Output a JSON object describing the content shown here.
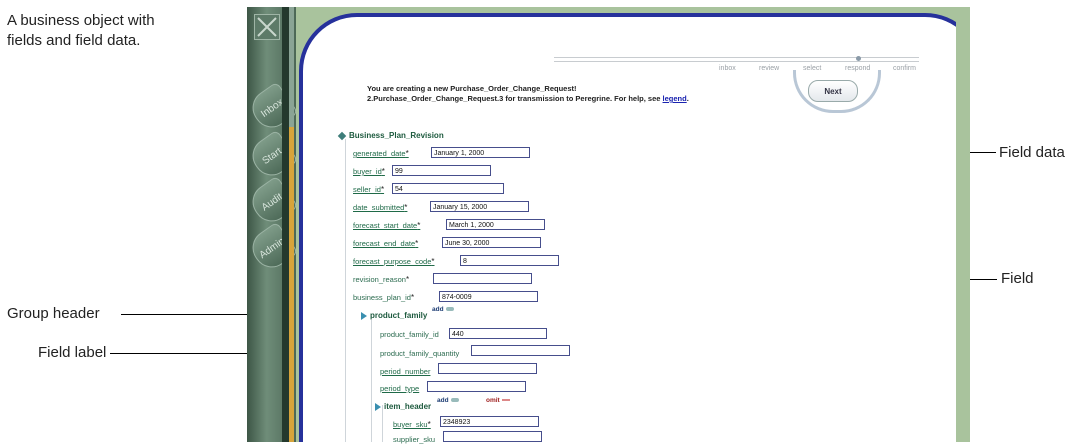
{
  "annotations": {
    "business_object_line1": "A business object with",
    "business_object_line2": "fields and field data.",
    "field_data": "Field data",
    "field": "Field",
    "group_header": "Group header",
    "field_label": "Field label"
  },
  "nav": {
    "items": [
      "Inbox",
      "Start",
      "Audit",
      "Admin"
    ]
  },
  "wizard": {
    "steps": [
      "inbox",
      "review",
      "select",
      "respond",
      "confirm"
    ],
    "current_step": "respond",
    "message_line1": "You are creating a new Purchase_Order_Change_Request!",
    "message_line2": "2.Purchase_Order_Change_Request.3 for transmission to Peregrine. For help, see",
    "legend_link": "legend",
    "message_end": ".",
    "next_label": "Next"
  },
  "form": {
    "title": "Business_Plan_Revision",
    "fields": [
      {
        "label": "generated_date",
        "required": "*",
        "value": "January 1, 2000"
      },
      {
        "label": "buyer_id",
        "required": "*",
        "value": "99"
      },
      {
        "label": "seller_id",
        "required": "*",
        "value": "54"
      },
      {
        "label": "date_submitted",
        "required": "*",
        "value": "January 15, 2000"
      },
      {
        "label": "forecast_start_date",
        "required": "*",
        "value": "March 1, 2000"
      },
      {
        "label": "forecast_end_date",
        "required": "*",
        "value": "June 30, 2000"
      },
      {
        "label": "forecast_purpose_code",
        "required": "*",
        "value": "8"
      },
      {
        "label": "revision_reason",
        "required": "*",
        "value": ""
      },
      {
        "label": "business_plan_id",
        "required": "*",
        "value": "874-0009"
      }
    ],
    "product_family": {
      "header": "product_family",
      "add_label": "add",
      "fields": [
        {
          "label": "product_family_id",
          "value": "440"
        },
        {
          "label": "product_family_quantity",
          "value": ""
        },
        {
          "label": "period_number",
          "value": ""
        },
        {
          "label": "period_type",
          "value": ""
        }
      ]
    },
    "item_header": {
      "header": "item_header",
      "add_label": "add",
      "omit_label": "omit",
      "fields": [
        {
          "label": "buyer_sku",
          "required": "*",
          "value": "2348923"
        },
        {
          "label": "supplier_sku",
          "value": ""
        }
      ]
    }
  },
  "colors": {
    "frame_green": "#a9c39d",
    "frame_border_blue": "#26319b",
    "accent_gold": "#d7a43b",
    "field_label_green": "#2b6b4f"
  }
}
